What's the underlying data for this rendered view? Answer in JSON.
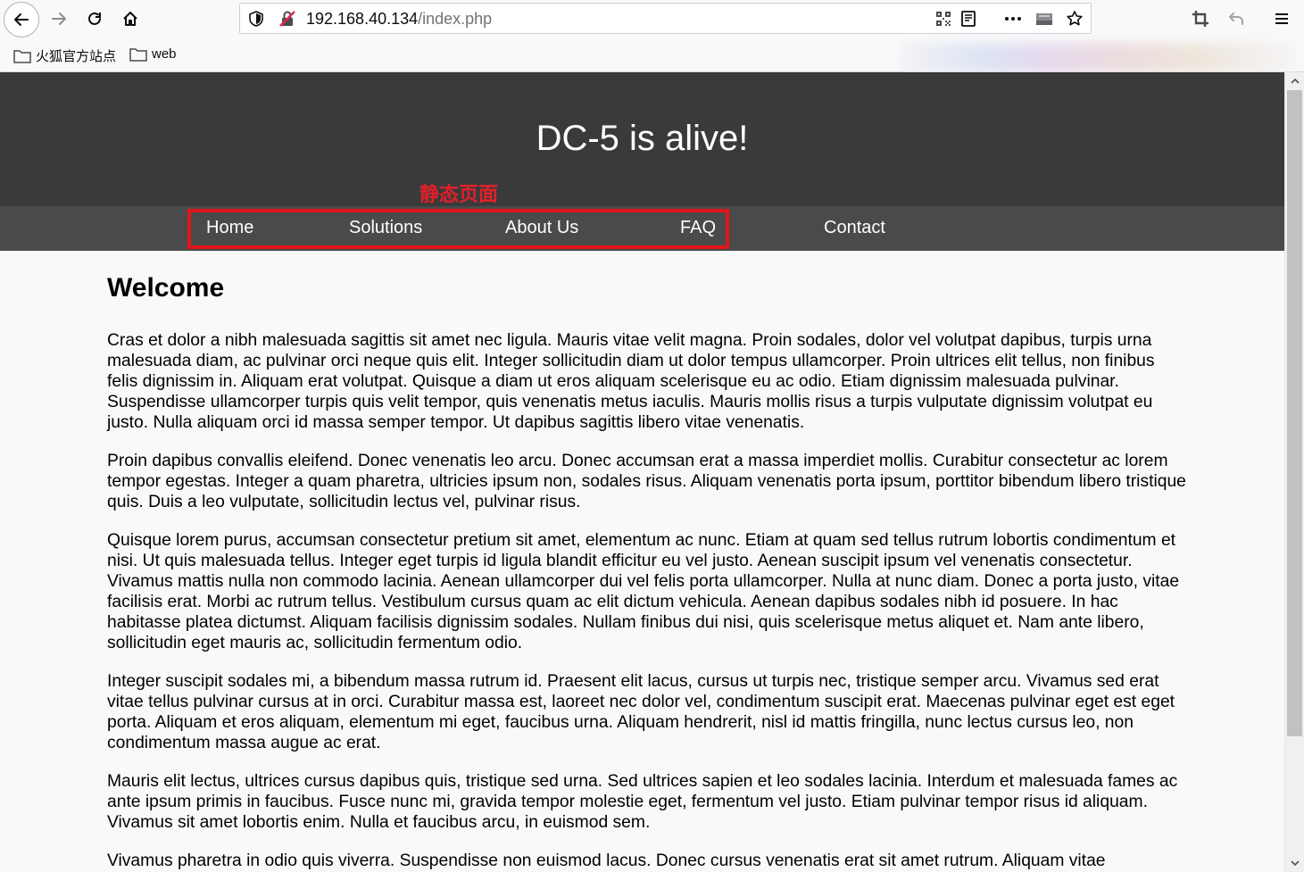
{
  "browser": {
    "url_host": "192.168.40.134",
    "url_path": "/index.php",
    "bookmarks": [
      {
        "label": "火狐官方站点"
      },
      {
        "label": "web"
      }
    ],
    "icons": [
      "back-icon",
      "forward-icon",
      "reload-icon",
      "home-icon",
      "shield-icon",
      "insecure-lock-icon",
      "qr-code-icon",
      "reader-mode-icon",
      "more-actions-icon",
      "screenshot-icon",
      "bookmark-star-icon",
      "crop-icon",
      "undo-icon",
      "menu-icon",
      "folder-icon"
    ]
  },
  "site": {
    "title": "DC-5 is alive!",
    "annotation": "静态页面",
    "annotation_color": "#e0202a",
    "header_bg": "#3a3a3a",
    "nav_bg": "#4a4a4a",
    "nav": [
      {
        "label": "Home"
      },
      {
        "label": "Solutions"
      },
      {
        "label": "About Us"
      },
      {
        "label": "FAQ"
      },
      {
        "label": "Contact"
      }
    ]
  },
  "content": {
    "heading": "Welcome",
    "paragraphs": [
      "Cras et dolor a nibh malesuada sagittis sit amet nec ligula. Mauris vitae velit magna. Proin sodales, dolor vel volutpat dapibus, turpis urna malesuada diam, ac pulvinar orci neque quis elit. Integer sollicitudin diam ut dolor tempus ullamcorper. Proin ultrices elit tellus, non finibus felis dignissim in. Aliquam erat volutpat. Quisque a diam ut eros aliquam scelerisque eu ac odio. Etiam dignissim malesuada pulvinar. Suspendisse ullamcorper turpis quis velit tempor, quis venenatis metus iaculis. Mauris mollis risus a turpis vulputate dignissim volutpat eu justo. Nulla aliquam orci id massa semper tempor. Ut dapibus sagittis libero vitae venenatis.",
      "Proin dapibus convallis eleifend. Donec venenatis leo arcu. Donec accumsan erat a massa imperdiet mollis. Curabitur consectetur ac lorem tempor egestas. Integer a quam pharetra, ultricies ipsum non, sodales risus. Aliquam venenatis porta ipsum, porttitor bibendum libero tristique quis. Duis a leo vulputate, sollicitudin lectus vel, pulvinar risus.",
      "Quisque lorem purus, accumsan consectetur pretium sit amet, elementum ac nunc. Etiam at quam sed tellus rutrum lobortis condimentum et nisi. Ut quis malesuada tellus. Integer eget turpis id ligula blandit efficitur eu vel justo. Aenean suscipit ipsum vel venenatis consectetur. Vivamus mattis nulla non commodo lacinia. Aenean ullamcorper dui vel felis porta ullamcorper. Nulla at nunc diam. Donec a porta justo, vitae facilisis erat. Morbi ac rutrum tellus. Vestibulum cursus quam ac elit dictum vehicula. Aenean dapibus sodales nibh id posuere. In hac habitasse platea dictumst. Aliquam facilisis dignissim sodales. Nullam finibus dui nisi, quis scelerisque metus aliquet et. Nam ante libero, sollicitudin eget mauris ac, sollicitudin fermentum odio.",
      "Integer suscipit sodales mi, a bibendum massa rutrum id. Praesent elit lacus, cursus ut turpis nec, tristique semper arcu. Vivamus sed erat vitae tellus pulvinar cursus at in orci. Curabitur massa est, laoreet nec dolor vel, condimentum suscipit erat. Maecenas pulvinar eget est eget porta. Aliquam et eros aliquam, elementum mi eget, faucibus urna. Aliquam hendrerit, nisl id mattis fringilla, nunc lectus cursus leo, non condimentum massa augue ac erat.",
      "Mauris elit lectus, ultrices cursus dapibus quis, tristique sed urna. Sed ultrices sapien et leo sodales lacinia. Interdum et malesuada fames ac ante ipsum primis in faucibus. Fusce nunc mi, gravida tempor molestie eget, fermentum vel justo. Etiam pulvinar tempor risus id aliquam. Vivamus sit amet lobortis enim. Nulla et faucibus arcu, in euismod sem.",
      "Vivamus pharetra in odio quis viverra. Suspendisse non euismod lacus. Donec cursus venenatis erat sit amet rutrum. Aliquam vitae"
    ]
  }
}
